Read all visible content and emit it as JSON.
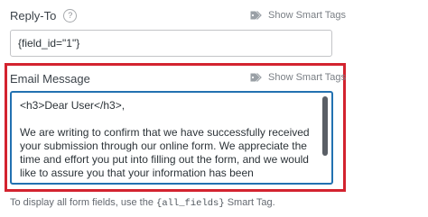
{
  "reply_to": {
    "label": "Reply-To",
    "help_icon": "question-circle-icon",
    "smart_tags_label": "Show Smart Tags",
    "value": "{field_id=\"1\"}"
  },
  "email_message": {
    "label": "Email Message",
    "smart_tags_label": "Show Smart Tags",
    "value": "<h3>Dear User</h3>,\n\nWe are writing to confirm that we have successfully received your submission through our online form. We appreciate the time and effort you put into filling out the form, and we would like to assure you that your information has been"
  },
  "helper": {
    "prefix": "To display all form fields, use the",
    "code": "{all_fields}",
    "suffix": "Smart Tag."
  },
  "colors": {
    "highlight_border": "#d3232f",
    "focus_border": "#2271b1"
  }
}
